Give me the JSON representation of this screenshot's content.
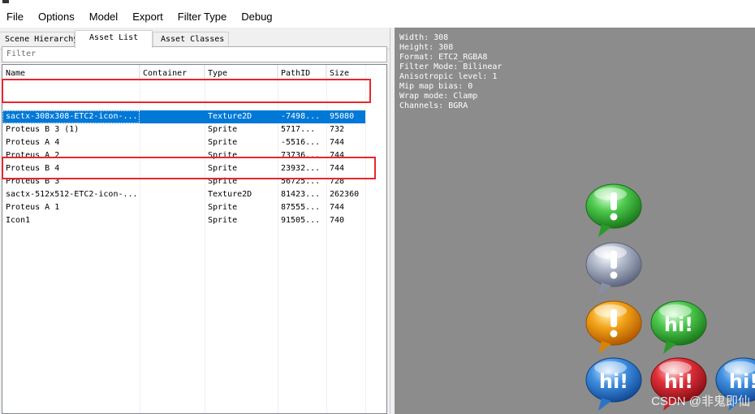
{
  "menu": {
    "items": [
      "File",
      "Options",
      "Model",
      "Export",
      "Filter Type",
      "Debug"
    ]
  },
  "tabs": {
    "scene_hierarchy": "Scene Hierarchy",
    "asset_list": "Asset List",
    "asset_classes": "Asset Classes"
  },
  "filter": {
    "placeholder": "Filter"
  },
  "columns": [
    "Name",
    "Container",
    "Type",
    "PathID",
    "Size"
  ],
  "rows": [
    [
      "sactx-308x308-ETC2-icon-...",
      "",
      "Texture2D",
      "-7498...",
      "95080"
    ],
    [
      "Proteus B 3 (1)",
      "",
      "Sprite",
      "5717...",
      "732"
    ],
    [
      "Proteus A 4",
      "",
      "Sprite",
      "-5516...",
      "744"
    ],
    [
      "Proteus A 2",
      "",
      "Sprite",
      "73736...",
      "744"
    ],
    [
      "Proteus B 4",
      "",
      "Sprite",
      "23932...",
      "744"
    ],
    [
      "Proteus B 3",
      "",
      "Sprite",
      "56725...",
      "728"
    ],
    [
      "sactx-512x512-ETC2-icon-...",
      "",
      "Texture2D",
      "81423...",
      "262360"
    ],
    [
      "Proteus A 1",
      "",
      "Sprite",
      "87555...",
      "744"
    ],
    [
      "Icon1",
      "",
      "Sprite",
      "91505...",
      "740"
    ]
  ],
  "info": {
    "width": "Width: 308",
    "height": "Height: 308",
    "format": "Format: ETC2_RGBA8",
    "filter_mode": "Filter Mode: Bilinear",
    "aniso": "Anisotropic level: 1",
    "mip_bias": "Mip map bias: 0",
    "wrap": "Wrap mode: Clamp",
    "channels": "Channels: BGRA"
  },
  "watermark": "CSDN @非鬼即仙",
  "colors": {
    "selection": "#0078d7",
    "annotation": "#e8262d",
    "preview_bg": "#8c8c8c"
  },
  "preview_icons": [
    "green-exclamation-bubble",
    "silver-exclamation-bubble",
    "orange-exclamation-bubble",
    "green-hi-bubble",
    "blue-hi-bubble",
    "red-hi-bubble",
    "blue-hi-bubble-partial"
  ]
}
